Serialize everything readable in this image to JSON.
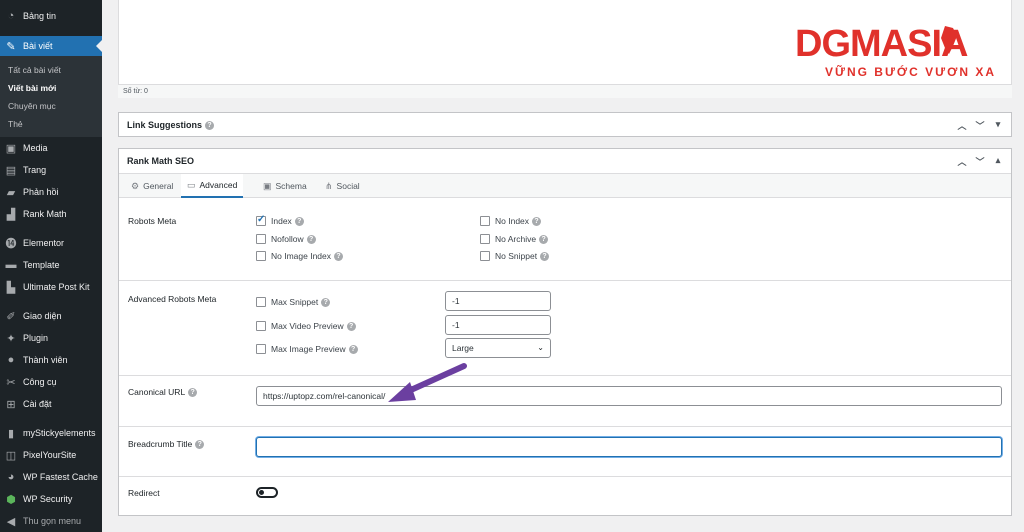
{
  "sidebar": {
    "items": [
      {
        "label": "Bảng tin",
        "icon": "dashboard-icon"
      },
      {
        "label": "Bài viết",
        "icon": "pin-icon",
        "active": true
      },
      {
        "label": "Media",
        "icon": "media-icon"
      },
      {
        "label": "Trang",
        "icon": "page-icon"
      },
      {
        "label": "Phản hồi",
        "icon": "comment-icon"
      },
      {
        "label": "Rank Math",
        "icon": "chart-icon"
      },
      {
        "label": "Elementor",
        "icon": "elementor-icon"
      },
      {
        "label": "Template",
        "icon": "folder-icon"
      },
      {
        "label": "Ultimate Post Kit",
        "icon": "kit-icon"
      },
      {
        "label": "Giao diện",
        "icon": "brush-icon"
      },
      {
        "label": "Plugin",
        "icon": "plugin-icon"
      },
      {
        "label": "Thành viên",
        "icon": "user-icon"
      },
      {
        "label": "Công cụ",
        "icon": "wrench-icon"
      },
      {
        "label": "Cài đặt",
        "icon": "settings-icon"
      },
      {
        "label": "myStickyelements",
        "icon": "sticky-icon"
      },
      {
        "label": "PixelYourSite",
        "icon": "pixel-icon"
      },
      {
        "label": "WP Fastest Cache",
        "icon": "cache-icon"
      },
      {
        "label": "WP Security",
        "icon": "shield-icon"
      },
      {
        "label": "Thu gọn menu",
        "icon": "collapse-icon"
      }
    ],
    "submenu": [
      "Tất cả bài viết",
      "Viết bài mới",
      "Chuyên mục",
      "Thẻ"
    ]
  },
  "editor": {
    "word_count": "Số từ: 0"
  },
  "link_suggestions": {
    "title": "Link Suggestions"
  },
  "rankmath": {
    "title": "Rank Math SEO",
    "tabs": [
      {
        "label": "General",
        "icon": "gear-icon"
      },
      {
        "label": "Advanced",
        "icon": "toolbox-icon",
        "active": true
      },
      {
        "label": "Schema",
        "icon": "schema-icon"
      },
      {
        "label": "Social",
        "icon": "social-icon"
      }
    ],
    "robots_meta": {
      "label": "Robots Meta",
      "options": [
        {
          "label": "Index",
          "checked": true
        },
        {
          "label": "No Index",
          "checked": false
        },
        {
          "label": "Nofollow",
          "checked": false
        },
        {
          "label": "No Archive",
          "checked": false
        },
        {
          "label": "No Image Index",
          "checked": false
        },
        {
          "label": "No Snippet",
          "checked": false
        }
      ]
    },
    "advanced_robots": {
      "label": "Advanced Robots Meta",
      "max_snippet": {
        "label": "Max Snippet",
        "value": "-1"
      },
      "max_video": {
        "label": "Max Video Preview",
        "value": "-1"
      },
      "max_image": {
        "label": "Max Image Preview",
        "value": "Large"
      }
    },
    "canonical": {
      "label": "Canonical URL",
      "value": "https://uptopz.com/rel-canonical/"
    },
    "breadcrumb": {
      "label": "Breadcrumb Title",
      "value": ""
    },
    "redirect": {
      "label": "Redirect",
      "enabled": false
    }
  },
  "logo": {
    "brand": "DGMASIA",
    "tagline": "VỮNG BƯỚC VƯƠN XA",
    "color": "#e0312b"
  },
  "colors": {
    "accent": "#2271b1",
    "arrow": "#6b3fa0",
    "sidebar": "#1d2327"
  }
}
